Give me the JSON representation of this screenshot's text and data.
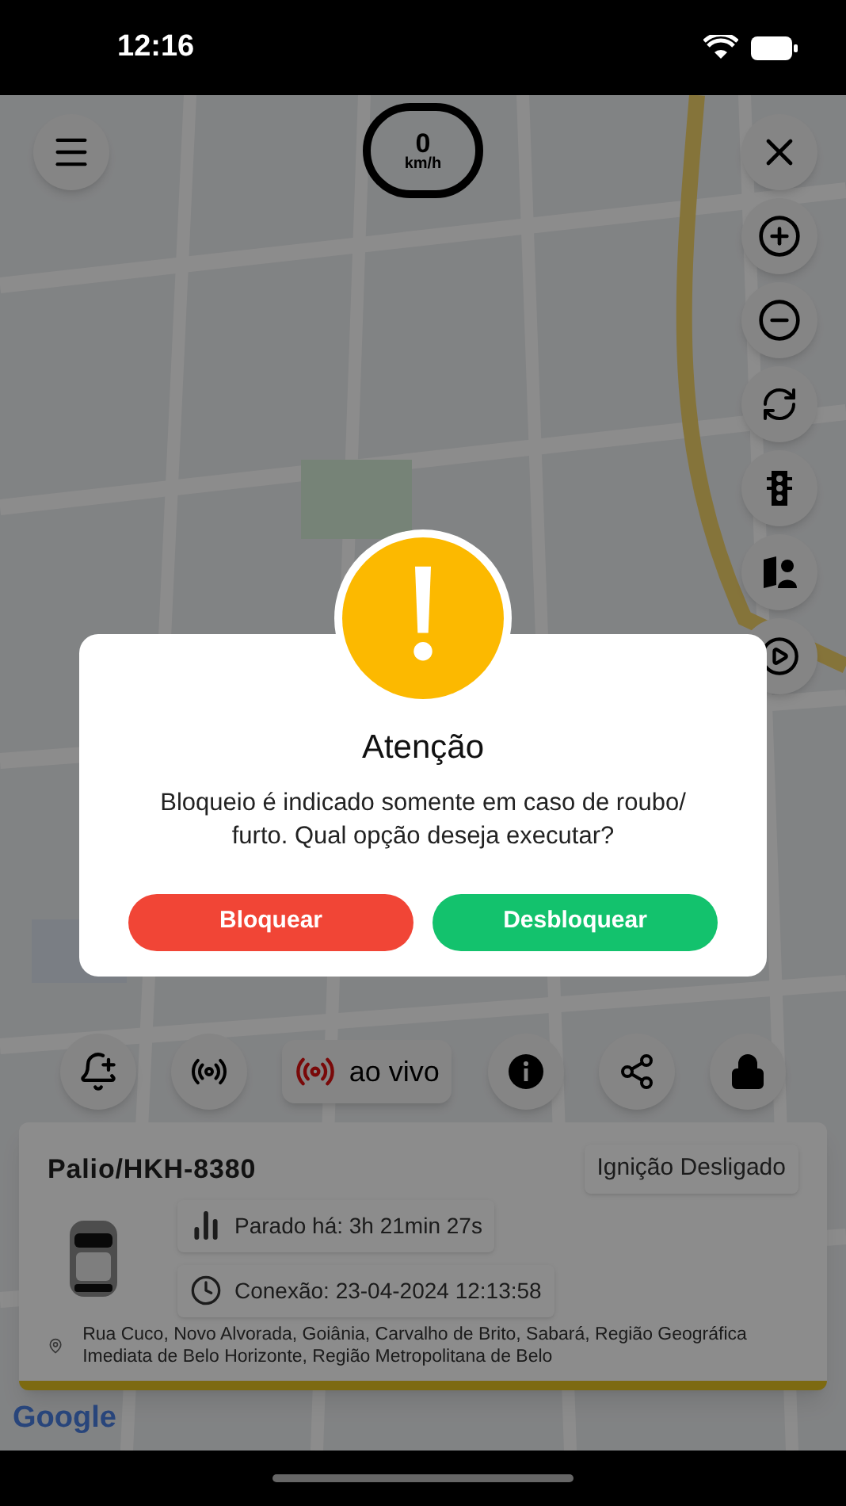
{
  "status_bar": {
    "time": "12:16"
  },
  "map": {
    "kind": "picture",
    "speed": {
      "value": "0",
      "unit": "km/h"
    },
    "attribution": "Google"
  },
  "actions": [
    {
      "kind": "alert"
    },
    {
      "kind": "broadcast"
    },
    {
      "kind": "live",
      "label": "ao vivo"
    },
    {
      "kind": "info"
    },
    {
      "kind": "share"
    },
    {
      "kind": "lock"
    }
  ],
  "vehicle": {
    "name": "Palio/HKH-8380",
    "ignition": "Ignição Desligado",
    "stopped": "Parado há: 3h 21min 27s",
    "connection": "Conexão: 23-04-2024 12:13:58",
    "address": "Rua Cuco, Novo Alvorada, Goiânia, Carvalho de Brito, Sabará, Região Geográfica Imediata de Belo Horizonte, Região Metropolitana de Belo"
  },
  "dialog": {
    "title": "Atenção",
    "message": "Bloqueio é indicado somente em caso de roubo/ furto. Qual opção deseja executar?",
    "buttons": [
      {
        "kind": "danger",
        "label": "Bloquear"
      },
      {
        "kind": "success",
        "label": "Desbloquear"
      }
    ]
  }
}
